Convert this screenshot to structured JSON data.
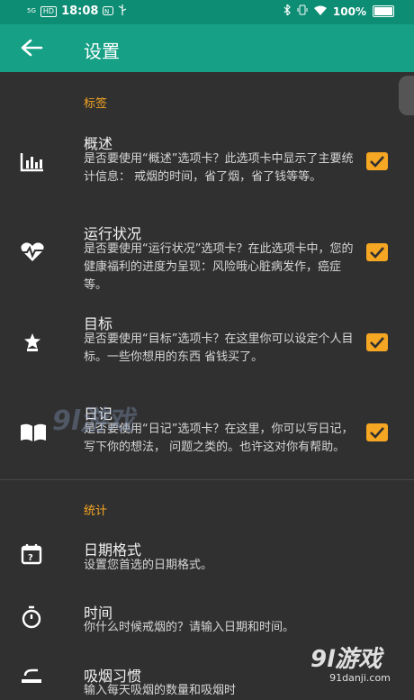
{
  "status_bar": {
    "signal_text": "5G",
    "hd": "HD",
    "time": "18:08",
    "battery": "100%",
    "icons": [
      "nfc-icon",
      "usb-icon",
      "bluetooth-icon",
      "vibrate-icon",
      "wifi-icon",
      "battery-icon"
    ]
  },
  "app_bar": {
    "title": "设置",
    "back_icon": "arrow-left-icon"
  },
  "sections": {
    "tabs": {
      "header": "标签",
      "items": [
        {
          "title": "概述",
          "desc": "是否要使用“概述”选项卡？此选项卡中显示了主要统计信息： 戒烟的时间，省了烟，省了钱等等。",
          "checked": true,
          "icon": "bar-chart-icon"
        },
        {
          "title": "运行状况",
          "desc": "是否要使用“运行状况”选项卡？在此选项卡中，您的健康福利的进度为呈现：风险哦心脏病发作，癌症等。",
          "checked": true,
          "icon": "heartbeat-icon"
        },
        {
          "title": "目标",
          "desc": "是否要使用“目标”选项卡？在这里你可以设定个人目标。一些你想用的东西 省钱买了。",
          "checked": true,
          "icon": "trophy-icon"
        },
        {
          "title": "日记",
          "desc": "是否要使用“日记”选项卡？在这里，你可以写日记，写下你的想法， 问题之类的。也许这对你有帮助。",
          "checked": true,
          "icon": "book-icon"
        }
      ]
    },
    "stats": {
      "header": "统计",
      "items": [
        {
          "title": "日期格式",
          "desc": "设置您首选的日期格式。",
          "icon": "calendar-icon"
        },
        {
          "title": "时间",
          "desc": "你什么时候戒烟的？请输入日期和时间。",
          "icon": "stopwatch-icon"
        },
        {
          "title": "吸烟习惯",
          "desc": "输入每天吸烟的数量和吸烟时",
          "icon": "cigarette-icon"
        }
      ]
    }
  },
  "watermarks": {
    "overlay": "9l游戏",
    "corner_main": "9l游戏",
    "corner_sub": "91danji.com"
  }
}
